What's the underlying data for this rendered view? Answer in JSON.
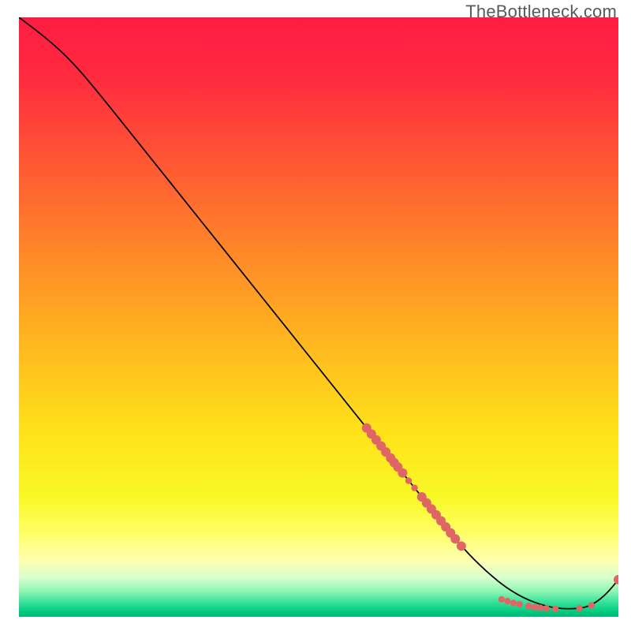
{
  "watermark": "TheBottleneck.com",
  "chart_data": {
    "type": "line",
    "title": "",
    "xlabel": "",
    "ylabel": "",
    "xlim": [
      0,
      100
    ],
    "ylim": [
      0,
      100
    ],
    "gradient_stops": [
      {
        "offset": 0.0,
        "color": "#ff1c44"
      },
      {
        "offset": 0.1,
        "color": "#ff2b3f"
      },
      {
        "offset": 0.25,
        "color": "#ff5a33"
      },
      {
        "offset": 0.4,
        "color": "#ff8a28"
      },
      {
        "offset": 0.55,
        "color": "#ffb91f"
      },
      {
        "offset": 0.7,
        "color": "#ffe41a"
      },
      {
        "offset": 0.8,
        "color": "#f8f826"
      },
      {
        "offset": 0.86,
        "color": "#ffff66"
      },
      {
        "offset": 0.905,
        "color": "#ffffb0"
      },
      {
        "offset": 0.935,
        "color": "#d6ffcd"
      },
      {
        "offset": 0.958,
        "color": "#8cf5b3"
      },
      {
        "offset": 0.975,
        "color": "#38e29a"
      },
      {
        "offset": 0.992,
        "color": "#00c97f"
      },
      {
        "offset": 1.0,
        "color": "#00b674"
      }
    ],
    "series": [
      {
        "name": "bottleneck-curve",
        "color": "#000000",
        "x": [
          0,
          4,
          8,
          12,
          20,
          30,
          40,
          50,
          58,
          64,
          70,
          74,
          78,
          82,
          86,
          90,
          94,
          96,
          98,
          100
        ],
        "y": [
          100,
          97,
          93.5,
          89,
          79,
          66.5,
          54,
          41.5,
          31.5,
          24,
          16.5,
          11.5,
          7.5,
          4.3,
          2.3,
          1.3,
          1.4,
          2.2,
          3.8,
          6.2
        ]
      }
    ],
    "markers": {
      "name": "data-points",
      "color": "#e06666",
      "radius_small": 4.2,
      "radius_large": 6.0,
      "points": [
        {
          "x": 58.0,
          "y": 31.5,
          "r": "large"
        },
        {
          "x": 58.8,
          "y": 30.5,
          "r": "large"
        },
        {
          "x": 59.6,
          "y": 29.5,
          "r": "large"
        },
        {
          "x": 60.4,
          "y": 28.5,
          "r": "large"
        },
        {
          "x": 61.2,
          "y": 27.5,
          "r": "large"
        },
        {
          "x": 62.0,
          "y": 26.5,
          "r": "large"
        },
        {
          "x": 62.6,
          "y": 25.7,
          "r": "large"
        },
        {
          "x": 63.2,
          "y": 25.0,
          "r": "large"
        },
        {
          "x": 64.0,
          "y": 24.0,
          "r": "large"
        },
        {
          "x": 65.0,
          "y": 22.7,
          "r": "small"
        },
        {
          "x": 66.0,
          "y": 21.5,
          "r": "small"
        },
        {
          "x": 67.2,
          "y": 20.0,
          "r": "large"
        },
        {
          "x": 68.0,
          "y": 19.0,
          "r": "large"
        },
        {
          "x": 68.8,
          "y": 18.0,
          "r": "large"
        },
        {
          "x": 69.6,
          "y": 17.0,
          "r": "large"
        },
        {
          "x": 70.4,
          "y": 16.0,
          "r": "large"
        },
        {
          "x": 71.2,
          "y": 15.0,
          "r": "large"
        },
        {
          "x": 72.0,
          "y": 14.0,
          "r": "large"
        },
        {
          "x": 72.8,
          "y": 13.0,
          "r": "large"
        },
        {
          "x": 73.8,
          "y": 11.8,
          "r": "large"
        },
        {
          "x": 80.5,
          "y": 2.9,
          "r": "small"
        },
        {
          "x": 81.5,
          "y": 2.6,
          "r": "small"
        },
        {
          "x": 82.5,
          "y": 2.3,
          "r": "small"
        },
        {
          "x": 83.5,
          "y": 2.1,
          "r": "small"
        },
        {
          "x": 85.0,
          "y": 1.8,
          "r": "small"
        },
        {
          "x": 86.0,
          "y": 1.6,
          "r": "small"
        },
        {
          "x": 87.0,
          "y": 1.5,
          "r": "small"
        },
        {
          "x": 88.0,
          "y": 1.4,
          "r": "small"
        },
        {
          "x": 89.5,
          "y": 1.3,
          "r": "small"
        },
        {
          "x": 93.5,
          "y": 1.4,
          "r": "small"
        },
        {
          "x": 95.5,
          "y": 1.9,
          "r": "small"
        },
        {
          "x": 100.0,
          "y": 6.2,
          "r": "large"
        }
      ]
    }
  }
}
